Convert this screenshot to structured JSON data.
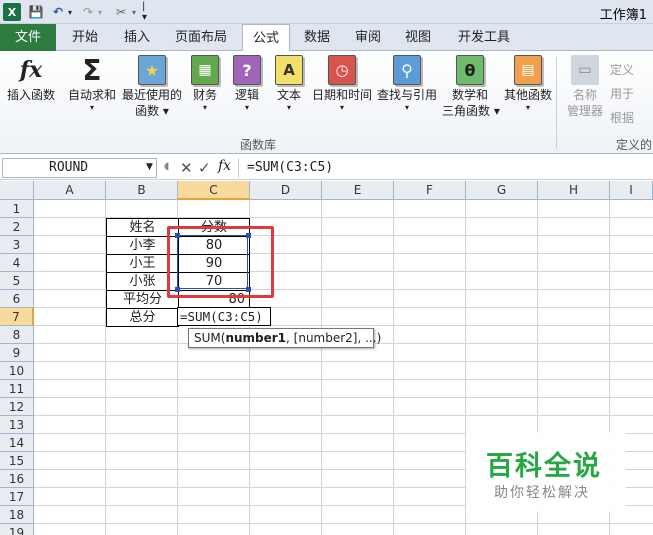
{
  "window": {
    "title": "工作簿1",
    "logo": "X"
  },
  "quick_access": {
    "save": "💾",
    "undo": "↶",
    "redo": "↷",
    "tools": "✂",
    "drop": "▾",
    "sep": "|▾"
  },
  "tabs": [
    "文件",
    "开始",
    "插入",
    "页面布局",
    "公式",
    "数据",
    "审阅",
    "视图",
    "开发工具"
  ],
  "ribbon": {
    "buttons": [
      {
        "glyph": "fx",
        "label": "插入函数",
        "label2": "",
        "drop": ""
      },
      {
        "glyph": "Σ",
        "label": "自动求和",
        "label2": "",
        "drop": "▾"
      },
      {
        "glyph": "★",
        "label": "最近使用的",
        "label2": "函数 ▾",
        "drop": ""
      },
      {
        "glyph": "▦",
        "label": "财务",
        "label2": "",
        "drop": "▾"
      },
      {
        "glyph": "?",
        "label": "逻辑",
        "label2": "",
        "drop": "▾"
      },
      {
        "glyph": "A",
        "label": "文本",
        "label2": "",
        "drop": "▾"
      },
      {
        "glyph": "◷",
        "label": "日期和时间",
        "label2": "",
        "drop": "▾"
      },
      {
        "glyph": "⚲",
        "label": "查找与引用",
        "label2": "",
        "drop": "▾"
      },
      {
        "glyph": "θ",
        "label": "数学和",
        "label2": "三角函数 ▾",
        "drop": ""
      },
      {
        "glyph": "▤",
        "label": "其他函数",
        "label2": "",
        "drop": "▾"
      }
    ],
    "group_label": "函数库",
    "name_manager": {
      "label": "名称",
      "label2": "管理器"
    },
    "defined_names": [
      "定义",
      "用于",
      "根据"
    ],
    "defined_group_label": "定义的"
  },
  "formula_bar": {
    "name_box": "ROUND",
    "cancel": "✕",
    "enter": "✓",
    "fx": "fx",
    "formula": "=SUM(C3:C5)"
  },
  "columns": [
    "A",
    "B",
    "C",
    "D",
    "E",
    "F",
    "G",
    "H",
    "I"
  ],
  "rows": [
    "1",
    "2",
    "3",
    "4",
    "5",
    "6",
    "7",
    "8",
    "9",
    "10",
    "11",
    "12",
    "13",
    "14",
    "15",
    "16",
    "17",
    "18",
    "19"
  ],
  "table": {
    "b2": "姓名",
    "c2": "分数",
    "b3": "小李",
    "c3": "80",
    "b4": "小王",
    "c4": "90",
    "b5": "小张",
    "c5": "70",
    "b6": "平均分",
    "c6": "80",
    "b7": "总分"
  },
  "edit_cell": "=SUM(C3:C5)",
  "tooltip": {
    "prefix": "SUM(",
    "bold": "number1",
    "rest": ", [number2], ...)"
  },
  "watermark": {
    "title": "百科全说",
    "subtitle": "助你轻松解决"
  },
  "colors": {
    "file_tab": "#2d7b3e",
    "selection": "#2c4fb5",
    "highlight": "#e0393e",
    "watermark": "#27a844"
  }
}
